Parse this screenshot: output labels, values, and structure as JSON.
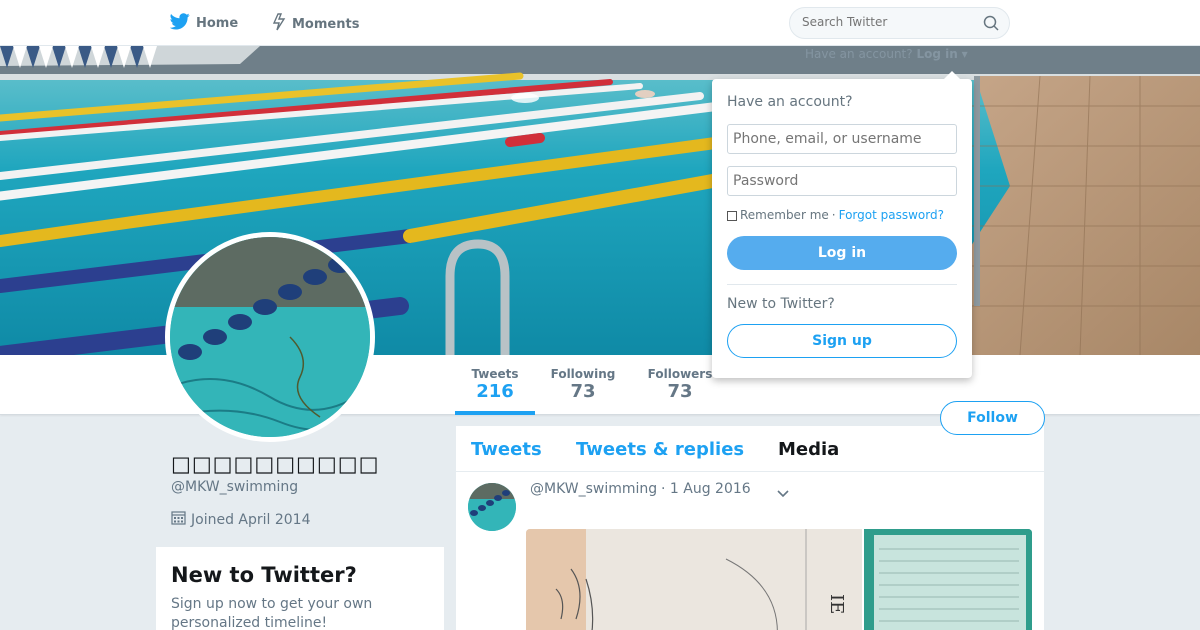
{
  "nav": {
    "home_label": "Home",
    "moments_label": "Moments",
    "search_placeholder": "Search Twitter"
  },
  "cover": {
    "login_hint_text": "Have an account?",
    "login_hint_link": "Log in"
  },
  "profile": {
    "display_name": "□□□□□□□□□□",
    "screen_name": "@MKW_swimming",
    "joined": "Joined April 2014"
  },
  "stats": {
    "tweets_label": "Tweets",
    "tweets_value": "216",
    "following_label": "Following",
    "following_value": "73",
    "followers_label": "Followers",
    "followers_value": "73"
  },
  "follow_label": "Follow",
  "signup_card": {
    "title": "New to Twitter?",
    "text": "Sign up now to get your own personalized timeline!"
  },
  "timeline": {
    "tabs": [
      "Tweets",
      "Tweets & replies",
      "Media"
    ],
    "selected_tab": "Media",
    "tweet": {
      "handle": "@MKW_swimming",
      "date": "· 1 Aug 2016"
    }
  },
  "login_panel": {
    "title": "Have an account?",
    "username_placeholder": "Phone, email, or username",
    "password_placeholder": "Password",
    "remember_label": "Remember me",
    "separator": "·",
    "forgot_label": "Forgot password?",
    "login_button": "Log in",
    "new_label": "New to Twitter?",
    "signup_button": "Sign up"
  },
  "colors": {
    "accent": "#1da1f2",
    "login_button": "#55acee",
    "background": "#e6ecf0"
  }
}
